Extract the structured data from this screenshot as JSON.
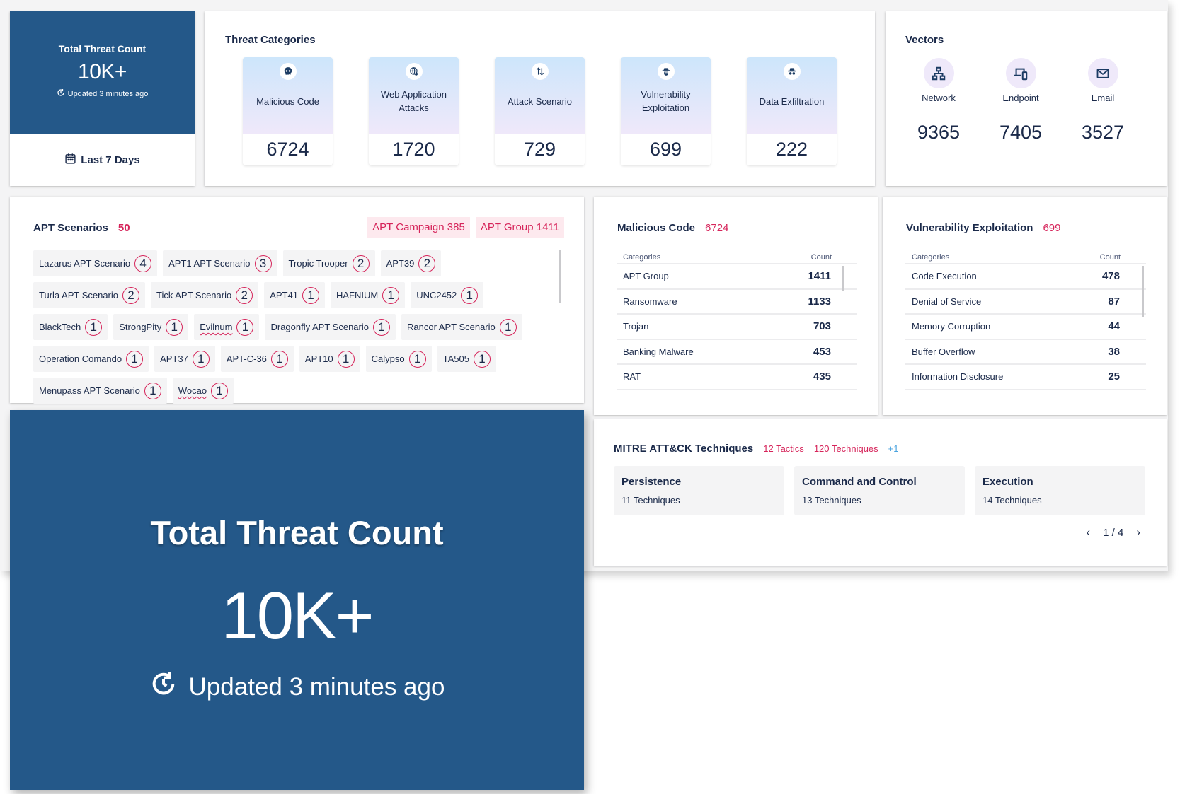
{
  "total_card": {
    "title": "Total Threat Count",
    "value": "10K+",
    "updated": "Updated 3 minutes ago",
    "range_label": "Last 7 Days"
  },
  "threat_categories": {
    "title": "Threat Categories",
    "items": [
      {
        "icon": "skull-icon",
        "label": "Malicious Code",
        "count": "6724"
      },
      {
        "icon": "globe-fire-icon",
        "label": "Web Application Attacks",
        "count": "1720"
      },
      {
        "icon": "arrows-up-down-icon",
        "label": "Attack Scenario",
        "count": "729"
      },
      {
        "icon": "bug-spy-icon",
        "label": "Vulnerability Exploitation",
        "count": "699"
      },
      {
        "icon": "spy-hat-icon",
        "label": "Data Exfiltration",
        "count": "222"
      }
    ]
  },
  "vectors": {
    "title": "Vectors",
    "items": [
      {
        "icon": "network-icon",
        "label": "Network",
        "count": "9365"
      },
      {
        "icon": "devices-icon",
        "label": "Endpoint",
        "count": "7405"
      },
      {
        "icon": "mail-icon",
        "label": "Email",
        "count": "3527"
      }
    ]
  },
  "apt_scenarios": {
    "title": "APT Scenarios",
    "count": "50",
    "badges": [
      "APT Campaign 385",
      "APT Group 1411"
    ],
    "chips": [
      {
        "name": "Lazarus APT Scenario",
        "count": "4"
      },
      {
        "name": "APT1 APT Scenario",
        "count": "3"
      },
      {
        "name": "Tropic Trooper",
        "count": "2"
      },
      {
        "name": "APT39",
        "count": "2"
      },
      {
        "name": "Turla APT Scenario",
        "count": "2"
      },
      {
        "name": "Tick APT Scenario",
        "count": "2"
      },
      {
        "name": "APT41",
        "count": "1"
      },
      {
        "name": "HAFNIUM",
        "count": "1"
      },
      {
        "name": "UNC2452",
        "count": "1"
      },
      {
        "name": "BlackTech",
        "count": "1"
      },
      {
        "name": "StrongPity",
        "count": "1"
      },
      {
        "name": "Evilnum",
        "count": "1",
        "spell": true
      },
      {
        "name": "Dragonfly APT Scenario",
        "count": "1"
      },
      {
        "name": "Rancor APT Scenario",
        "count": "1"
      },
      {
        "name": "Operation Comando",
        "count": "1"
      },
      {
        "name": "APT37",
        "count": "1"
      },
      {
        "name": "APT-C-36",
        "count": "1"
      },
      {
        "name": "APT10",
        "count": "1"
      },
      {
        "name": "Calypso",
        "count": "1"
      },
      {
        "name": "TA505",
        "count": "1"
      },
      {
        "name": "Menupass APT Scenario",
        "count": "1"
      },
      {
        "name": "Wocao",
        "count": "1",
        "spell": true
      }
    ]
  },
  "malicious_code": {
    "title": "Malicious Code",
    "count": "6724",
    "col_category": "Categories",
    "col_count": "Count",
    "rows": [
      {
        "name": "APT Group",
        "value": "1411"
      },
      {
        "name": "Ransomware",
        "value": "1133"
      },
      {
        "name": "Trojan",
        "value": "703"
      },
      {
        "name": "Banking Malware",
        "value": "453"
      },
      {
        "name": "RAT",
        "value": "435"
      }
    ]
  },
  "vulnerability_exploitation": {
    "title": "Vulnerability Exploitation",
    "count": "699",
    "col_category": "Categories",
    "col_count": "Count",
    "rows": [
      {
        "name": "Code Execution",
        "value": "478"
      },
      {
        "name": "Denial of Service",
        "value": "87"
      },
      {
        "name": "Memory Corruption",
        "value": "44"
      },
      {
        "name": "Buffer Overflow",
        "value": "38"
      },
      {
        "name": "Information Disclosure",
        "value": "25"
      }
    ]
  },
  "mitre": {
    "title": "MITRE ATT&CK Techniques",
    "tactics_label": "12 Tactics",
    "techniques_label": "120 Techniques",
    "more_label": "+1",
    "tactics": [
      {
        "name": "Persistence",
        "count_label": "11 Techniques"
      },
      {
        "name": "Command and Control",
        "count_label": "13 Techniques"
      },
      {
        "name": "Execution",
        "count_label": "14 Techniques"
      }
    ],
    "pager": {
      "label": "1 / 4",
      "prev": "‹",
      "next": "›"
    }
  },
  "colors": {
    "brand_blue": "#245889",
    "accent_pink": "#d6245a",
    "accent_light_blue": "#4aa3df",
    "text_dark": "#1b2a4a"
  }
}
